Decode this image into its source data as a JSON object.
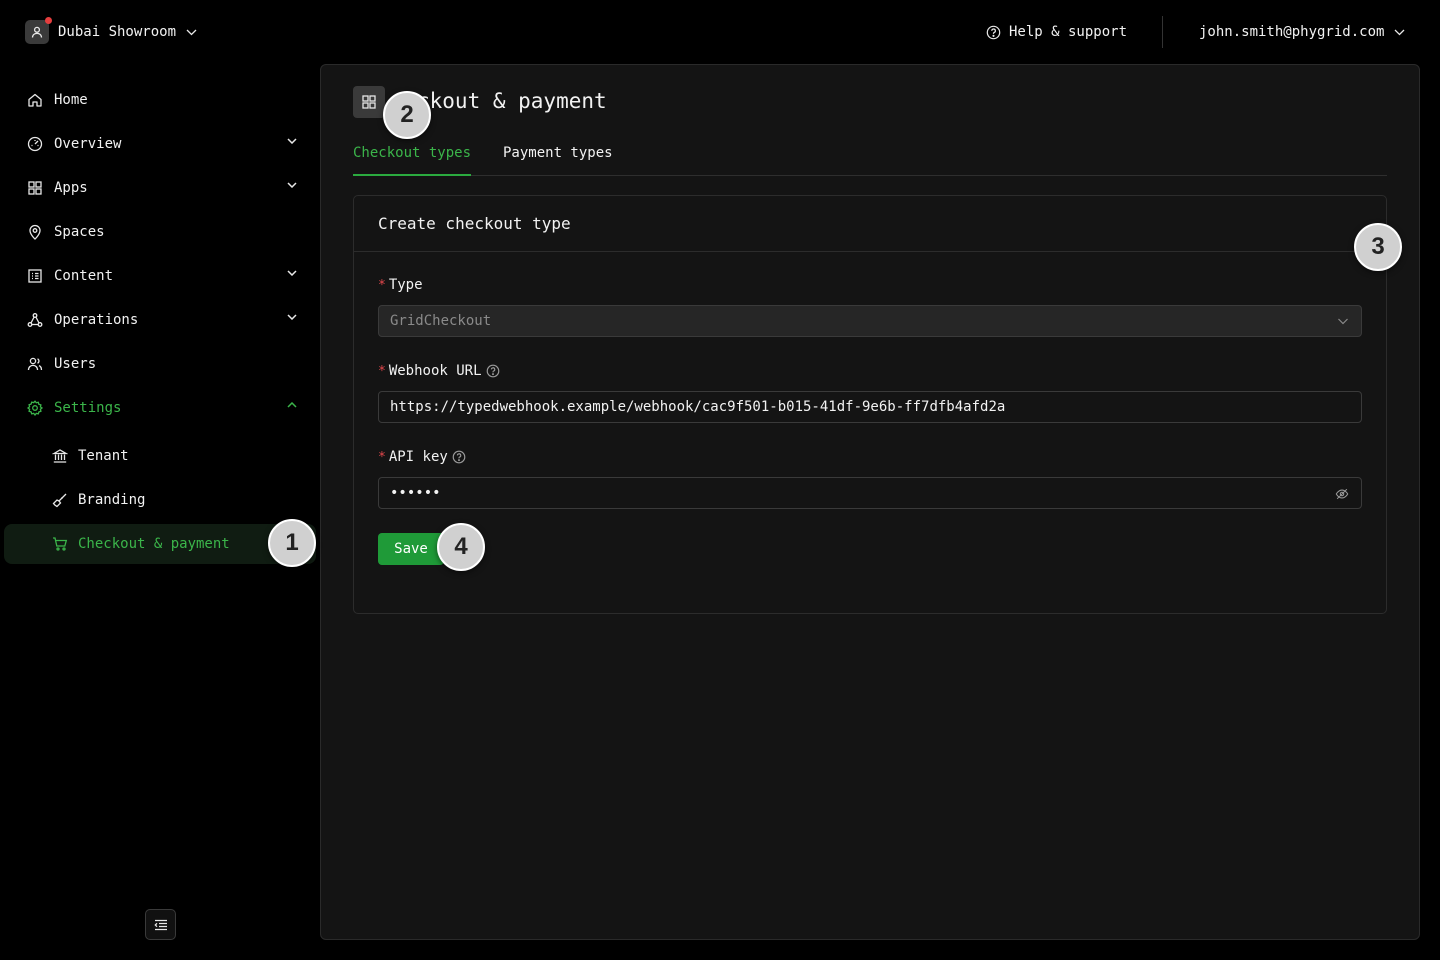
{
  "topbar": {
    "org_name": "Dubai Showroom",
    "help_label": "Help & support",
    "user_email": "john.smith@phygrid.com"
  },
  "sidebar": {
    "items": [
      {
        "label": "Home",
        "icon": "home-icon"
      },
      {
        "label": "Overview",
        "icon": "gauge-icon",
        "expandable": true
      },
      {
        "label": "Apps",
        "icon": "apps-grid-icon",
        "expandable": true
      },
      {
        "label": "Spaces",
        "icon": "map-pin-icon"
      },
      {
        "label": "Content",
        "icon": "content-list-icon",
        "expandable": true
      },
      {
        "label": "Operations",
        "icon": "network-icon",
        "expandable": true
      },
      {
        "label": "Users",
        "icon": "users-icon"
      },
      {
        "label": "Settings",
        "icon": "gear-icon",
        "expanded": true,
        "accent": "#3bb54a"
      }
    ],
    "sub_items": [
      {
        "label": "Tenant",
        "icon": "bank-icon"
      },
      {
        "label": "Branding",
        "icon": "brush-icon"
      },
      {
        "label": "Checkout & payment",
        "icon": "cart-icon",
        "active": true
      }
    ]
  },
  "main": {
    "title_full": "Checkout & payment",
    "title_visible": "ckout & payment",
    "tabs": [
      {
        "label": "Checkout types",
        "active": true
      },
      {
        "label": "Payment types",
        "active": false
      }
    ],
    "form": {
      "heading": "Create checkout type",
      "type_label": "Type",
      "type_value": "GridCheckout",
      "webhook_label": "Webhook URL",
      "webhook_value": "https://typedwebhook.example/webhook/cac9f501-b015-41df-9e6b-ff7dfb4afd2a",
      "apikey_label": "API key",
      "apikey_masked": "••••••",
      "required_mark": "*",
      "save_label": "Save"
    }
  },
  "annotations": [
    "1",
    "2",
    "3",
    "4"
  ],
  "colors": {
    "accent": "#3bb54a",
    "save_button": "#1f9a38",
    "required": "#e5484d",
    "background": "#000000",
    "panel": "#141414"
  }
}
